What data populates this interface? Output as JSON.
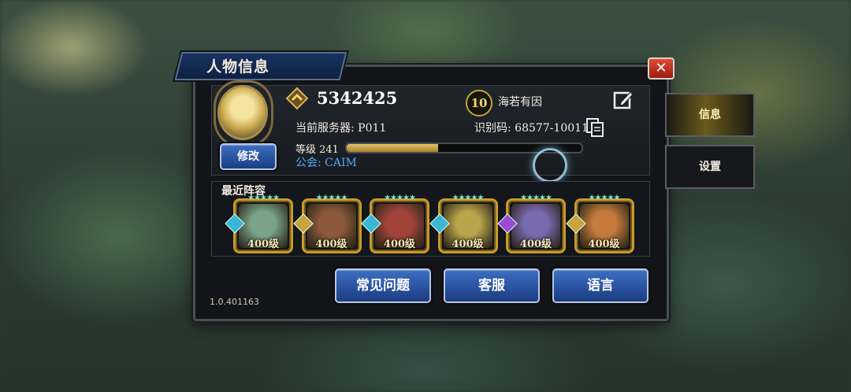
{
  "window": {
    "title": "人物信息",
    "close_label": "✕"
  },
  "side_tabs": [
    {
      "label": "信息",
      "active": true
    },
    {
      "label": "设置",
      "active": false
    }
  ],
  "profile": {
    "modify_label": "修改",
    "power": "5342425",
    "server": "当前服务器: P011",
    "level": "等级 241",
    "level_progress": 0.39,
    "guild": "公会: CAIM",
    "rank": "10",
    "nickname": "海若有因",
    "uid": "识别码: 68577-10011"
  },
  "lineup": {
    "title": "最近阵容",
    "heroes": [
      {
        "level": "400级",
        "stars": "★★★★★",
        "color": "#7aa38a",
        "element": "#3ab6d6"
      },
      {
        "level": "400级",
        "stars": "★★★★★",
        "color": "#8c5a3a",
        "element": "#c9a33b"
      },
      {
        "level": "400级",
        "stars": "★★★★★",
        "color": "#a3443a",
        "element": "#3ab6d6"
      },
      {
        "level": "400级",
        "stars": "★★★★★",
        "color": "#b8a44a",
        "element": "#3ab6d6"
      },
      {
        "level": "400级",
        "stars": "★★★★★",
        "color": "#7a6ab0",
        "element": "#9b4bd6"
      },
      {
        "level": "400级",
        "stars": "★★★★★",
        "color": "#c47a3a",
        "element": "#c9a33b"
      }
    ]
  },
  "actions": {
    "faq": "常见问题",
    "support": "客服",
    "language": "语言"
  },
  "version": "1.0.401163",
  "icons": {
    "power": "crown-chevron-icon",
    "edit": "edit-icon",
    "copy": "copy-icon"
  },
  "colors": {
    "accent_gold": "#c9a33b",
    "button_blue": "#2c5aa8",
    "guild_blue": "#55a8ff"
  }
}
